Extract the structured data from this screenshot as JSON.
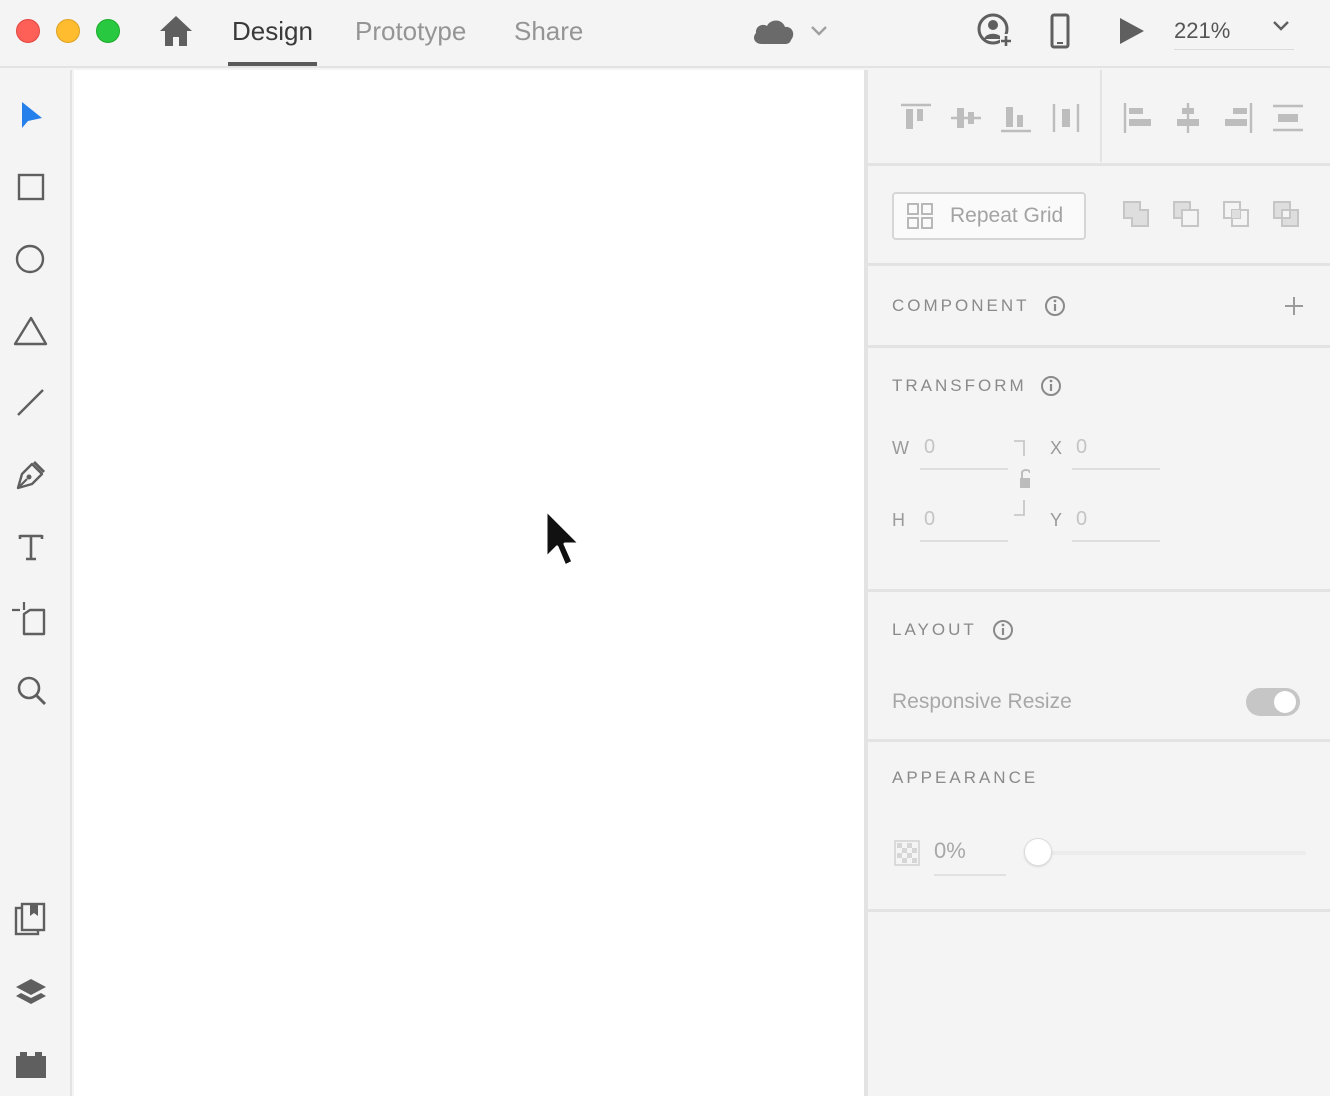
{
  "titlebar": {
    "tabs": [
      {
        "label": "Design",
        "active": true
      },
      {
        "label": "Prototype",
        "active": false
      },
      {
        "label": "Share",
        "active": false
      }
    ],
    "zoom": "221%"
  },
  "toolbar": {
    "tools": [
      "select-icon",
      "rectangle-icon",
      "ellipse-icon",
      "polygon-icon",
      "line-icon",
      "pen-icon",
      "text-icon",
      "artboard-icon",
      "zoom-icon"
    ],
    "bottom_tools": [
      "assets-icon",
      "layers-icon",
      "plugins-icon"
    ],
    "selected_tool": "select",
    "accent_color": "#2680eb"
  },
  "inspector": {
    "repeat_grid_label": "Repeat Grid",
    "component_title": "COMPONENT",
    "transform_title": "TRANSFORM",
    "transform": {
      "w_label": "W",
      "w_value": "0",
      "h_label": "H",
      "h_value": "0",
      "x_label": "X",
      "x_value": "0",
      "y_label": "Y",
      "y_value": "0"
    },
    "layout_title": "LAYOUT",
    "responsive_resize_label": "Responsive Resize",
    "responsive_resize_on": true,
    "appearance_title": "APPEARANCE",
    "opacity_value": "0%",
    "opacity_fraction": 0
  }
}
